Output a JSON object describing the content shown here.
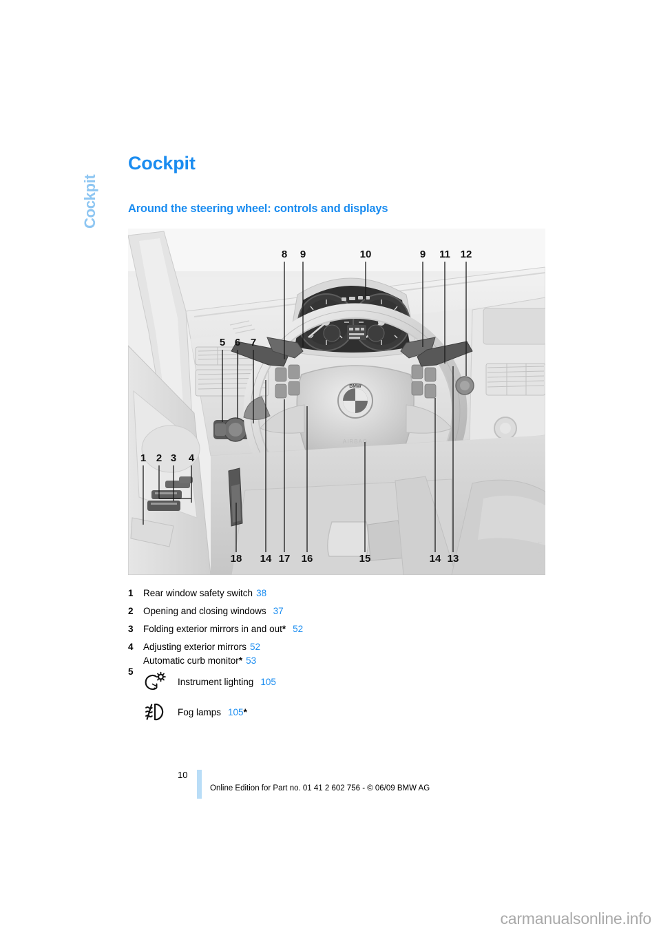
{
  "chapter_tab": {
    "label": "Cockpit"
  },
  "page_title": "Cockpit",
  "section_title": "Around the steering wheel: controls and displays",
  "figure": {
    "code": "HXCOCKPIT",
    "callouts_top": [
      "8",
      "9",
      "10",
      "9",
      "11",
      "12"
    ],
    "callouts_left": [
      "5",
      "6",
      "7"
    ],
    "callouts_door": [
      "1",
      "2",
      "3",
      "4"
    ],
    "callouts_bottom": [
      "18",
      "14",
      "17",
      "16",
      "15",
      "14",
      "13"
    ],
    "steering_wheel_logo": "BMW",
    "airbag_label": "AIRBAG"
  },
  "legend": [
    {
      "num": "1",
      "lines": [
        {
          "text": "Rear window safety switch",
          "star": false,
          "page": "38"
        }
      ]
    },
    {
      "num": "2",
      "lines": [
        {
          "text": "Opening and closing windows",
          "star": false,
          "page": "37"
        }
      ]
    },
    {
      "num": "3",
      "lines": [
        {
          "text": "Folding exterior mirrors in and out",
          "star": true,
          "page": "52"
        }
      ]
    },
    {
      "num": "4",
      "lines": [
        {
          "text": "Adjusting exterior mirrors",
          "star": false,
          "page": "52"
        },
        {
          "text": "Automatic curb monitor",
          "star": true,
          "page": "53"
        }
      ]
    }
  ],
  "legend_icons": {
    "num": "5",
    "rows": [
      {
        "icon": "instrument-lighting-icon",
        "label": "Instrument lighting",
        "page": "105",
        "star": false
      },
      {
        "icon": "fog-lamps-icon",
        "label": "Fog lamps",
        "page": "105",
        "star": true
      }
    ]
  },
  "footer": {
    "page_number": "10",
    "text": "Online Edition for Part no. 01 41 2 602 756 - © 06/09 BMW AG"
  },
  "watermark": "carmanualsonline.info",
  "colors": {
    "heading_blue": "#1a8cf0",
    "tab_blue": "#8ec6f2",
    "page_bar_blue": "#b9ddf7",
    "link_blue": "#1a8cf0"
  }
}
